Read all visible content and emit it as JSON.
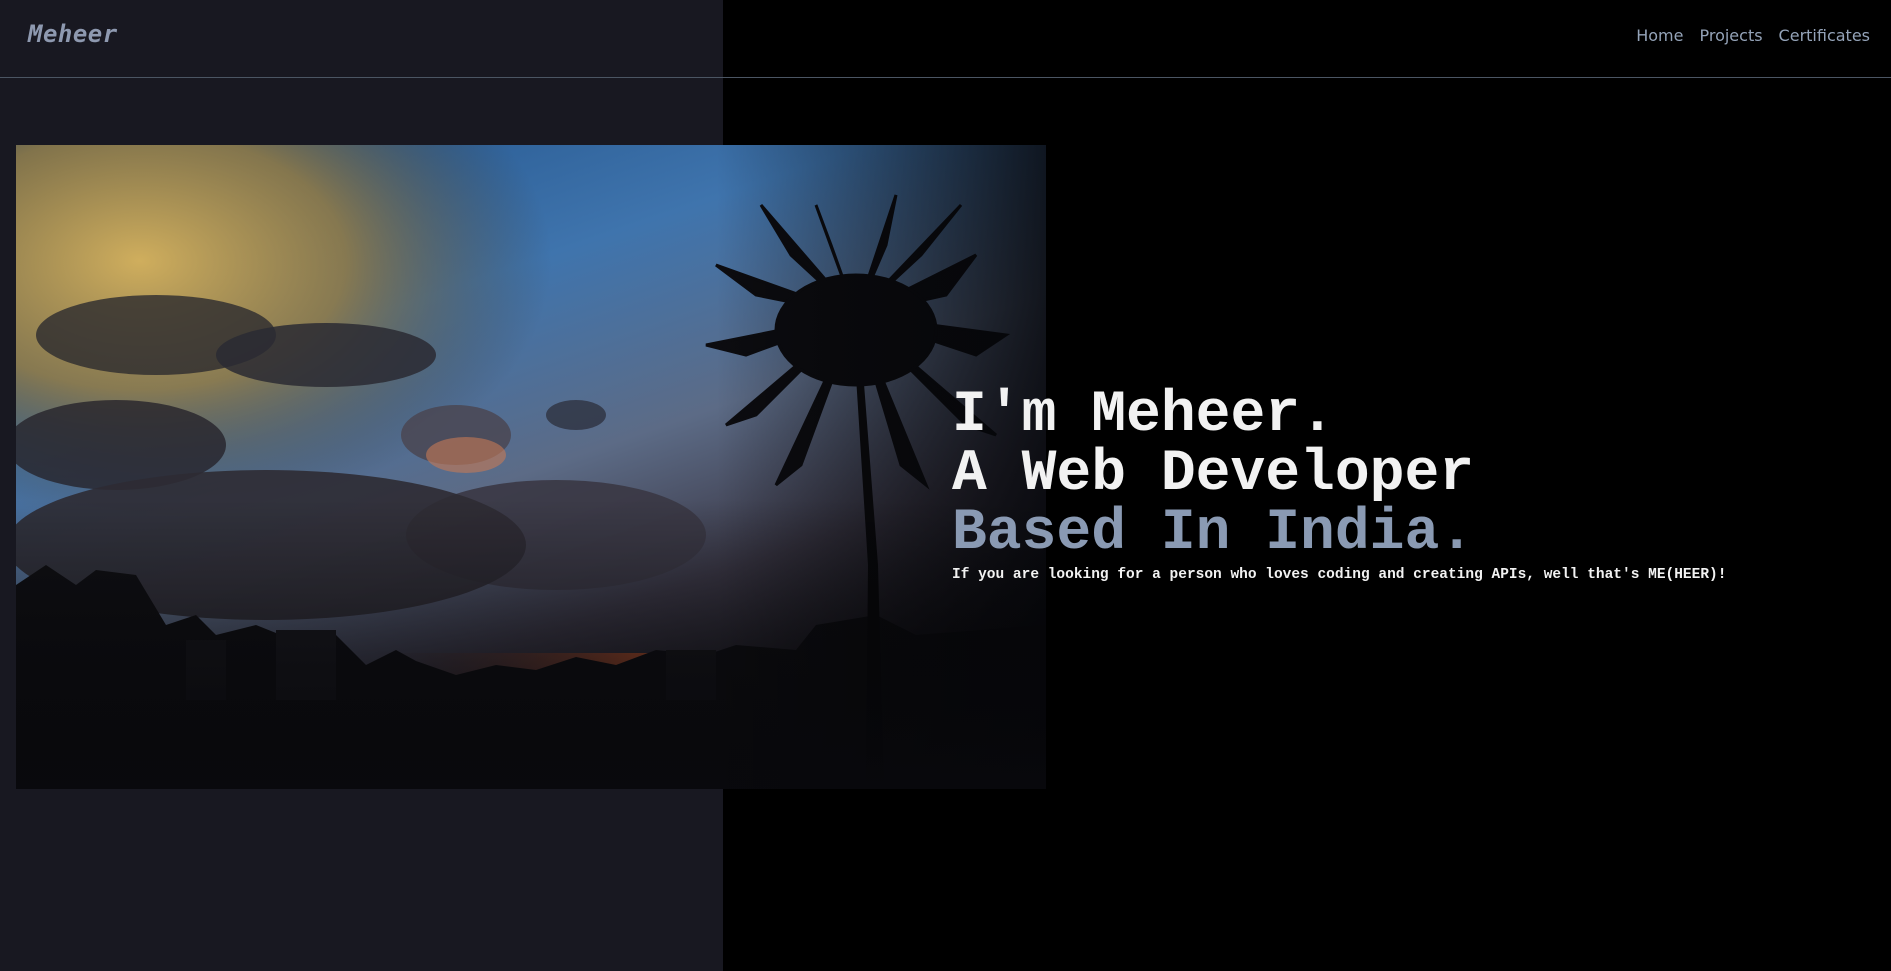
{
  "brand": {
    "name": "Meheer"
  },
  "nav": {
    "links": [
      {
        "label": "Home"
      },
      {
        "label": "Projects"
      },
      {
        "label": "Certificates"
      }
    ]
  },
  "hero": {
    "line1": "I'm Meheer.",
    "line2": "A Web Developer",
    "line3": "Based In India.",
    "tagline": "If you are looking for a person who loves coding and creating APIs, well that's ME(HEER)!"
  },
  "colors": {
    "background": "#000000",
    "left_panel": "#181821",
    "accent": "#8a9ab3",
    "text": "#f2f2f2",
    "nav_text": "#94a3b8"
  }
}
